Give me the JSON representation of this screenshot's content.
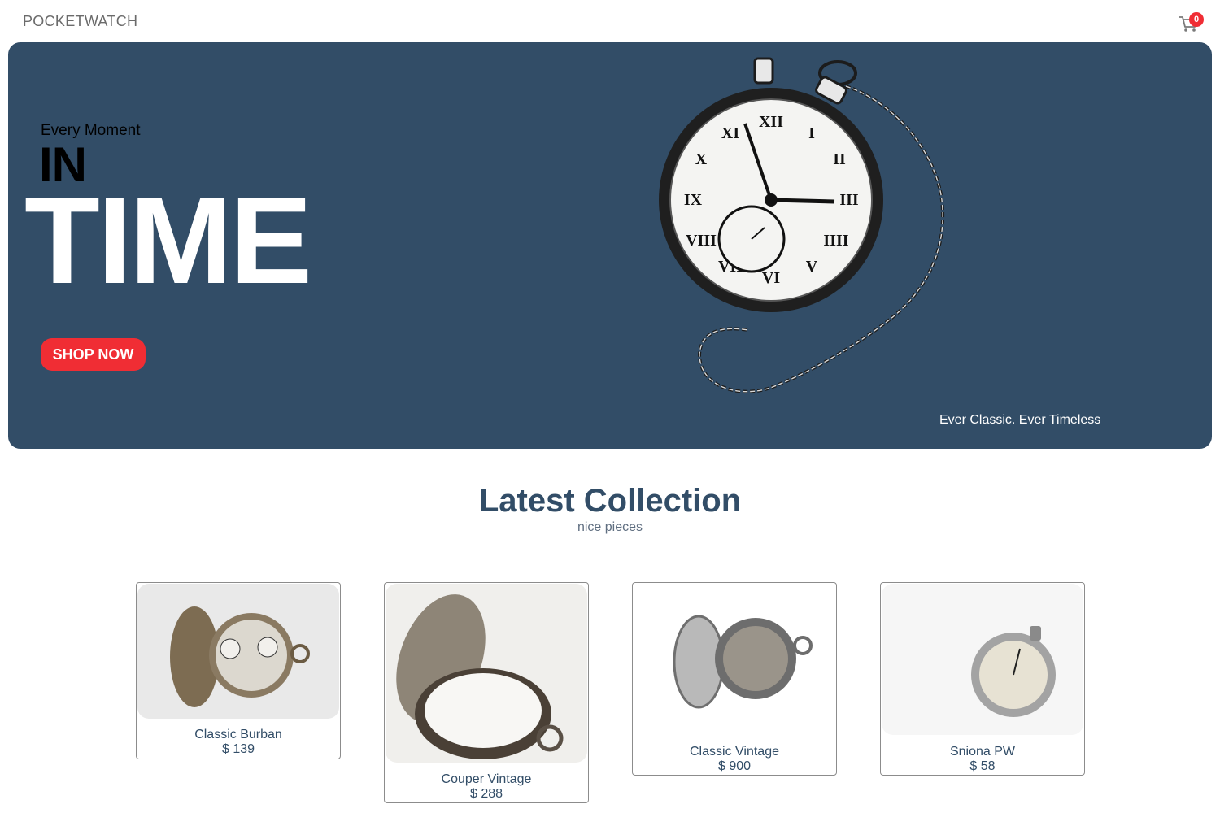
{
  "navbar": {
    "logo": "POCKETWATCH",
    "cart_count": "0"
  },
  "hero": {
    "small_text": "Every Moment",
    "mid_text": "IN",
    "large_text": "TIME",
    "button_label": "SHOP NOW",
    "tagline": "Ever Classic. Ever Timeless"
  },
  "collection": {
    "title": "Latest Collection",
    "subtitle": "nice pieces",
    "products": [
      {
        "name": "Classic Burban",
        "price": "$ 139"
      },
      {
        "name": "Couper Vintage",
        "price": "$ 288"
      },
      {
        "name": "Classic Vintage",
        "price": "$ 900"
      },
      {
        "name": "Sniona PW",
        "price": "$ 58"
      }
    ]
  },
  "colors": {
    "accent": "#f02d34",
    "hero_bg": "#324d67"
  }
}
